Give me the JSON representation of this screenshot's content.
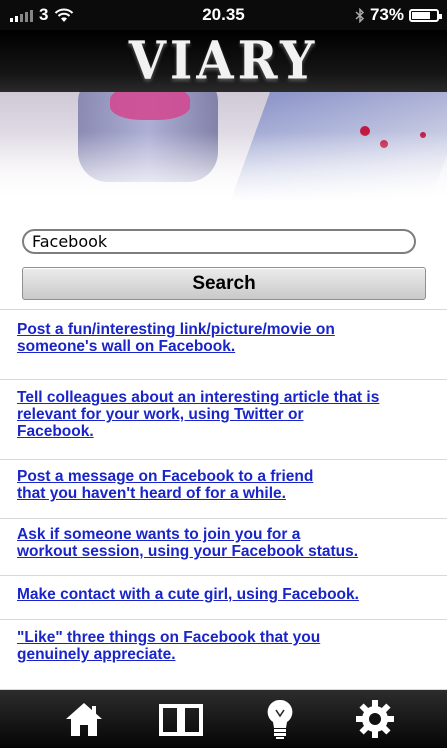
{
  "status_bar": {
    "carrier": "3",
    "time": "20.35",
    "battery_percent": "73%",
    "battery_level": 0.73
  },
  "header": {
    "logo": "VIARY"
  },
  "search": {
    "value": "Facebook",
    "button_label": "Search"
  },
  "results": [
    {
      "text": "Post a fun/interesting link/picture/movie on\nsomeone's wall on Facebook."
    },
    {
      "text": "Tell colleagues about an interesting article that is\nrelevant for your work, using Twitter or\nFacebook."
    },
    {
      "text": "Post a message on Facebook to a friend\nthat you haven't heard of for a while."
    },
    {
      "text": "Ask if someone wants to join you for a\nworkout session, using your Facebook status."
    },
    {
      "text": "Make contact with a cute girl, using Facebook."
    },
    {
      "text": "\"Like\" three things on Facebook that you\ngenuinely appreciate."
    }
  ],
  "tabbar": {
    "items": [
      {
        "icon": "home-icon"
      },
      {
        "icon": "book-icon"
      },
      {
        "icon": "lightbulb-icon"
      },
      {
        "icon": "gear-icon"
      }
    ]
  },
  "colors": {
    "link": "#1a25c9",
    "bar": "#0b0b0b"
  }
}
